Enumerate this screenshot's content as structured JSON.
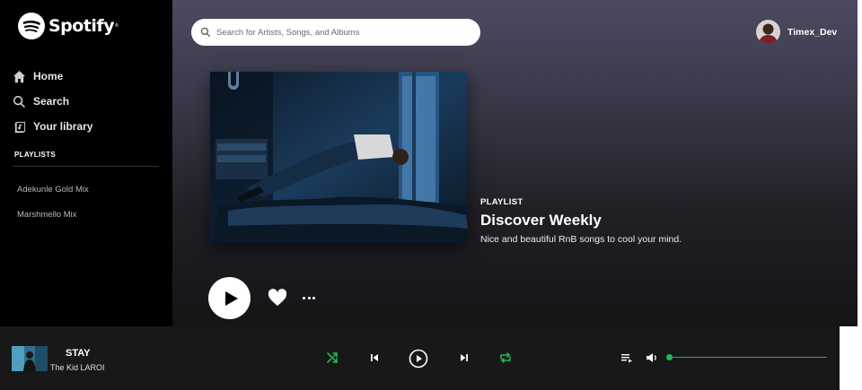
{
  "brand": {
    "name": "Spotify",
    "accent": "#1db954"
  },
  "sidebar": {
    "nav": [
      {
        "label": "Home",
        "icon": "home-icon"
      },
      {
        "label": "Search",
        "icon": "search-icon"
      },
      {
        "label": "Your library",
        "icon": "library-icon"
      }
    ],
    "playlists_header": "PLAYLISTS",
    "playlists": [
      "Adekunle Gold Mix",
      "Marshmello Mix"
    ]
  },
  "header": {
    "search_placeholder": "Search for Artists, Songs, and Albums",
    "username": "Timex_Dev"
  },
  "playlist": {
    "type": "PLAYLIST",
    "title": "Discover Weekly",
    "description": "Nice and beautiful RnB songs to cool your mind."
  },
  "player": {
    "track": "STAY",
    "artist": "The Kid LAROI",
    "volume": 0.0
  }
}
